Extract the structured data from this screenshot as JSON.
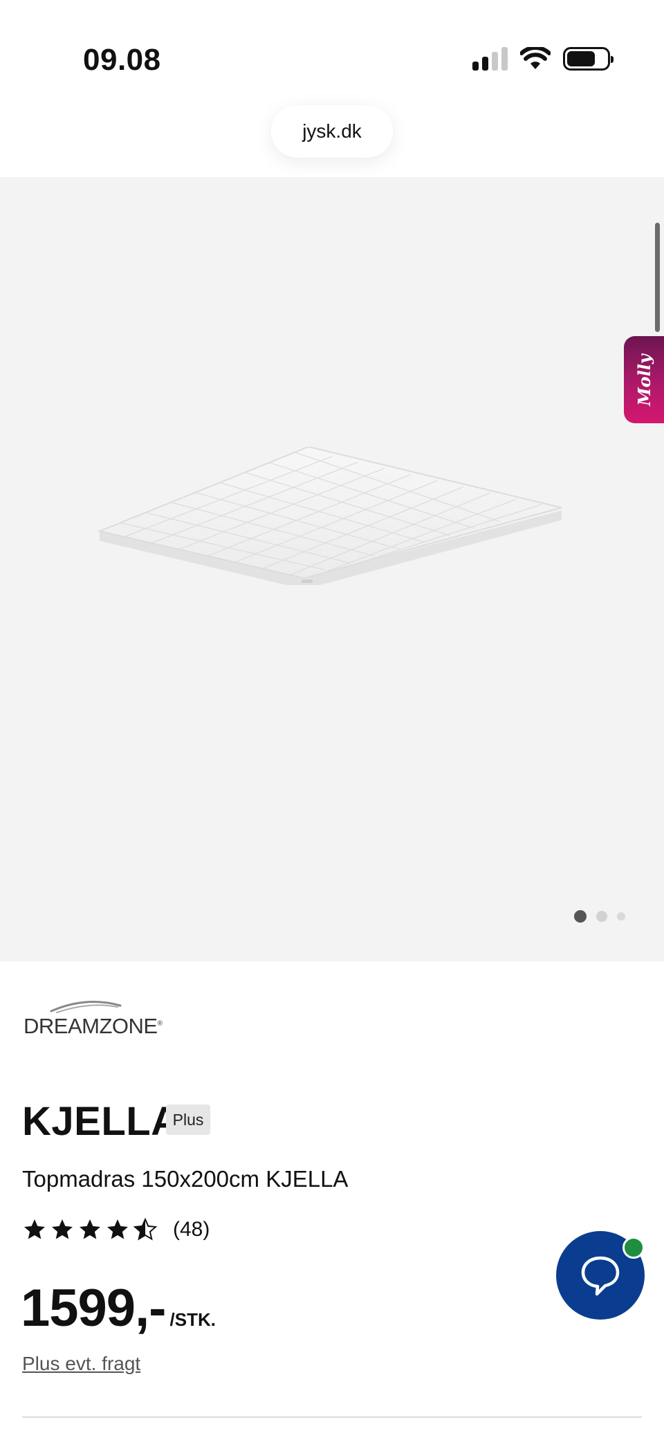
{
  "status_bar": {
    "time": "09.08"
  },
  "browser": {
    "url": "jysk.dk"
  },
  "gallery": {
    "side_tab_label": "Molly",
    "image_count": 3,
    "active_index": 0
  },
  "product": {
    "brand": "DREAMZONE",
    "name": "KJELLA",
    "badge": "Plus",
    "subtitle": "Topmadras 150x200cm KJELLA",
    "rating_value": 4.5,
    "rating_max": 5,
    "rating_count": "(48)",
    "price": "1599,-",
    "price_unit": "/STK.",
    "shipping_note": "Plus evt. fragt"
  },
  "colors": {
    "chat_button": "#0a3d8f",
    "online_dot": "#1f8e3e",
    "molly_gradient_start": "#6b1650",
    "molly_gradient_end": "#d4176f"
  }
}
